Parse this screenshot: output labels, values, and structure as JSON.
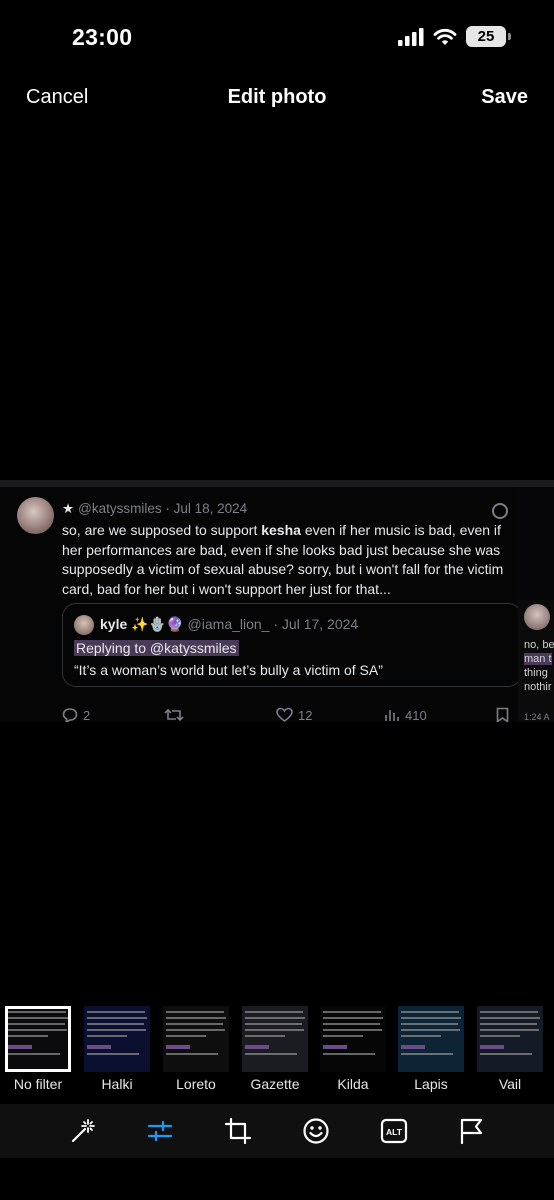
{
  "status_bar": {
    "time": "23:00",
    "battery": "25"
  },
  "header": {
    "cancel": "Cancel",
    "title": "Edit photo",
    "save": "Save"
  },
  "tweet": {
    "handle": "@katyssmiles",
    "date": "Jul 18, 2024",
    "body_pre": "so, are we supposed to support ",
    "body_bold": "kesha",
    "body_post": " even if her music is bad, even if her performances are bad, even if she looks bad just because she was supposedly a victim of sexual abuse? sorry, but i won't fall for the victim card, bad for her but i won't support her just for that...",
    "quote": {
      "name": "kyle",
      "emojis": "✨🪬🔮",
      "handle": "@iama_lion_",
      "date": "Jul 17, 2024",
      "replying": "Replying to @katyssmiles",
      "text": "“It’s a woman’s world but let’s bully a victim of SA”"
    },
    "replies": "2",
    "likes": "12",
    "views": "410"
  },
  "side_tweet": {
    "line1": "no, be",
    "line2": "man t",
    "line3": "thing",
    "line4": "nothir",
    "time": "1:24 A"
  },
  "filters": [
    {
      "label": "No filter",
      "tint": "#0b0b0d",
      "selected": true
    },
    {
      "label": "Halki",
      "tint": "#0c1030"
    },
    {
      "label": "Loreto",
      "tint": "#0e0e0e"
    },
    {
      "label": "Gazette",
      "tint": "#1a1c22"
    },
    {
      "label": "Kilda",
      "tint": "#060606"
    },
    {
      "label": "Lapis",
      "tint": "#0c2436"
    },
    {
      "label": "Vail",
      "tint": "#141a26"
    }
  ],
  "toolbar": {
    "icons": [
      "magic-wand-icon",
      "adjust-sliders-icon",
      "crop-icon",
      "sticker-smiley-icon",
      "alt-text-icon",
      "flag-icon"
    ],
    "alt_label": "ALT",
    "active_color": "#1d9bf0"
  }
}
